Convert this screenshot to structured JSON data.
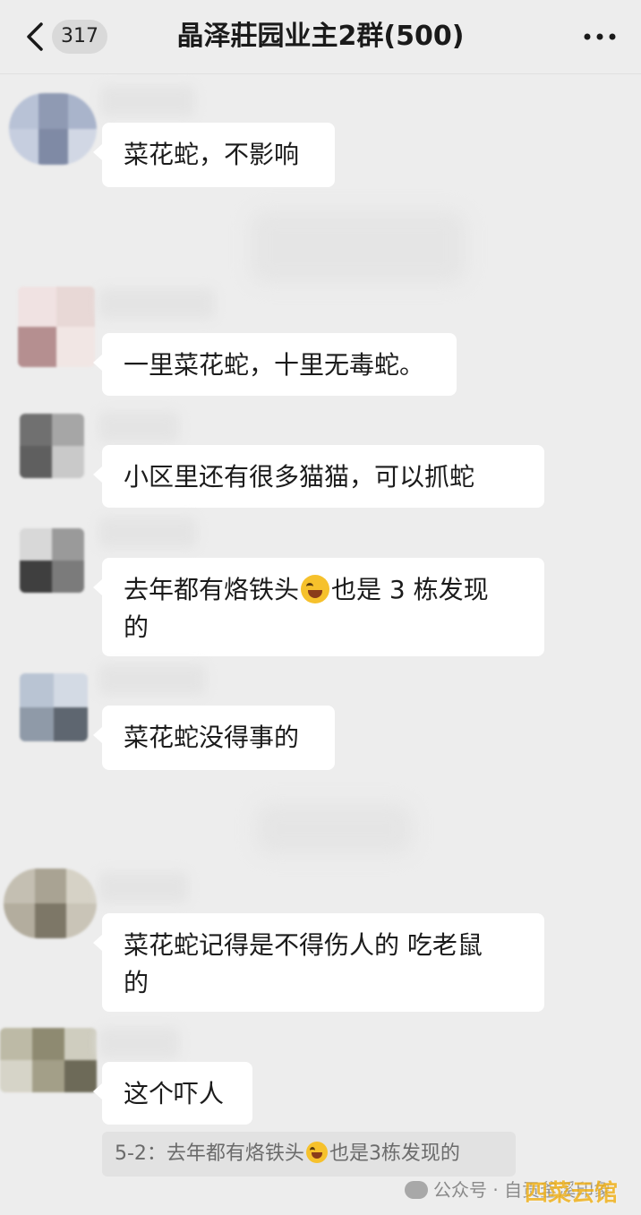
{
  "header": {
    "back_icon": "chevron-left-icon",
    "unread_count": "317",
    "title": "晶泽莊园业主2群(500)",
    "more_icon": "more-dots-icon"
  },
  "messages": [
    {
      "text": "菜花蛇，不影响"
    },
    {
      "text": "一里菜花蛇，十里无毒蛇。"
    },
    {
      "text": "小区里还有很多猫猫，可以抓蛇"
    },
    {
      "text_before_emoji": "去年都有烙铁头",
      "emoji": "laughing-crying-emoji",
      "text_after_emoji": "也是 3 栋发现\n的"
    },
    {
      "text": "菜花蛇没得事的"
    },
    {
      "text": "菜花蛇记得是不得伤人的 吃老鼠\n的"
    },
    {
      "text": "这个吓人"
    }
  ],
  "quote": {
    "text_before_emoji": "5-2：去年都有烙铁头",
    "emoji": "laughing-crying-emoji",
    "text_after_emoji": "也是3栋发现的"
  },
  "watermark": {
    "icon": "wechat-icon",
    "text": "公众号 · 自贡釜溪印象",
    "logo_text": "四菜云馆"
  },
  "colors": {
    "background": "#ededed",
    "bubble": "#ffffff",
    "text": "#1b1b1b",
    "quote_background": "#e2e2e2"
  }
}
